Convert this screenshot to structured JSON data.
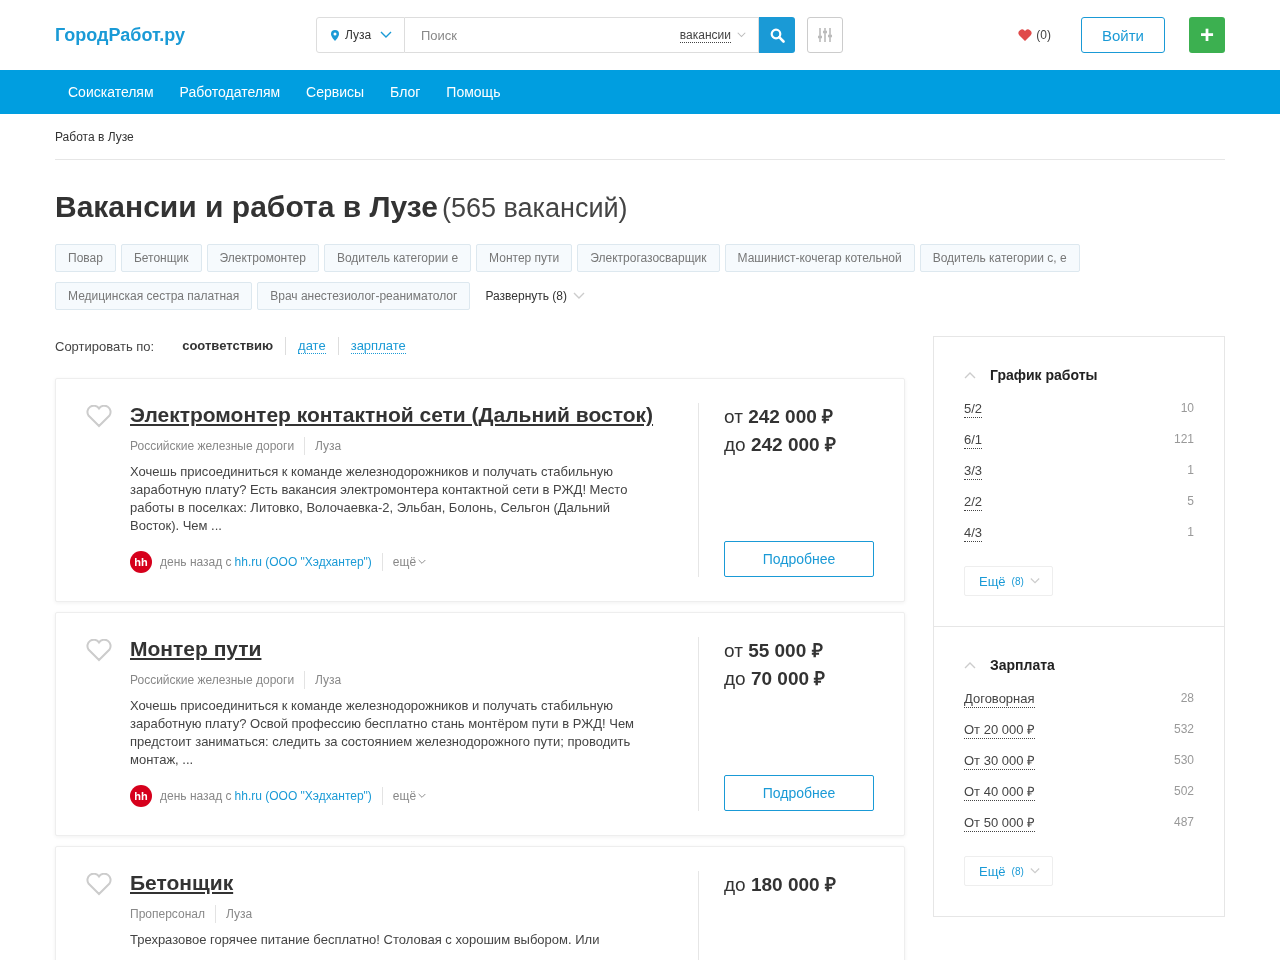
{
  "header": {
    "logo": "ГородРабот.ру",
    "city": "Луза",
    "search_placeholder": "Поиск",
    "search_scope": "вакансии",
    "favorites_count": "(0)",
    "login": "Войти",
    "add": "+"
  },
  "nav": [
    "Соискателям",
    "Работодателям",
    "Сервисы",
    "Блог",
    "Помощь"
  ],
  "breadcrumb": "Работа в Лузе",
  "title": "Вакансии и работа в Лузе",
  "count": "(565 вакансий)",
  "tags": [
    "Повар",
    "Бетонщик",
    "Электромонтер",
    "Водитель категории е",
    "Монтер пути",
    "Электрогазосварщик",
    "Машинист-кочегар котельной",
    "Водитель категории с, е",
    "Медицинская сестра палатная",
    "Врач анестезиолог-реаниматолог"
  ],
  "expand": "Развернуть (8)",
  "sort": {
    "label": "Сортировать по:",
    "options": [
      {
        "label": "соответствию",
        "selected": true
      },
      {
        "label": "дате",
        "selected": false
      },
      {
        "label": "зарплате",
        "selected": false
      }
    ]
  },
  "vacancies": [
    {
      "title": "Электромонтер контактной сети (Дальний восток)",
      "company": "Российские железные дороги",
      "city": "Луза",
      "description": "Хочешь присоединиться к команде железнодорожников и получать стабильную заработную плату? Есть вакансия электромонтера контактной сети в РЖД! Место работы в поселках: Литовко, Волочаевка-2, Эльбан, Болонь, Сельгон (Дальний Восток). Чем ...",
      "source_logo": "hh",
      "source_time": "день назад с",
      "source_link": "hh.ru (ООО \"Хэдхантер\")",
      "more": "ещё",
      "salary": [
        "от **242 000 ₽**",
        "до **242 000 ₽**"
      ],
      "details": "Подробнее"
    },
    {
      "title": "Монтер пути",
      "company": "Российские железные дороги",
      "city": "Луза",
      "description": "Хочешь присоединиться к команде железнодорожников и получать стабильную заработную плату? Освой профессию бесплатно стань монтёром пути в РЖД! Чем предстоит заниматься: следить за состоянием железнодорожного пути; проводить монтаж, ...",
      "source_logo": "hh",
      "source_time": "день назад с",
      "source_link": "hh.ru (ООО \"Хэдхантер\")",
      "more": "ещё",
      "salary": [
        "от **55 000 ₽**",
        "до **70 000 ₽**"
      ],
      "details": "Подробнее"
    },
    {
      "title": "Бетонщик",
      "company": "Проперсонал",
      "city": "Луза",
      "description": "Трехразовое горячее питание бесплатно! Столовая с хорошим выбором. Или",
      "salary": [
        "до **180 000 ₽**"
      ]
    }
  ],
  "filters": [
    {
      "title": "График работы",
      "expanded": true,
      "items": [
        {
          "label": "5/2",
          "count": "10"
        },
        {
          "label": "6/1",
          "count": "121"
        },
        {
          "label": "3/3",
          "count": "1"
        },
        {
          "label": "2/2",
          "count": "5"
        },
        {
          "label": "4/3",
          "count": "1"
        }
      ],
      "more": "Ещё",
      "more_count": "(8)"
    },
    {
      "title": "Зарплата",
      "expanded": true,
      "items": [
        {
          "label": "Договорная",
          "count": "28"
        },
        {
          "label": "От 20 000 ₽",
          "count": "532"
        },
        {
          "label": "От 30 000 ₽",
          "count": "530"
        },
        {
          "label": "От 40 000 ₽",
          "count": "502"
        },
        {
          "label": "От 50 000 ₽",
          "count": "487"
        }
      ],
      "more": "Ещё",
      "more_count": "(8)"
    }
  ]
}
